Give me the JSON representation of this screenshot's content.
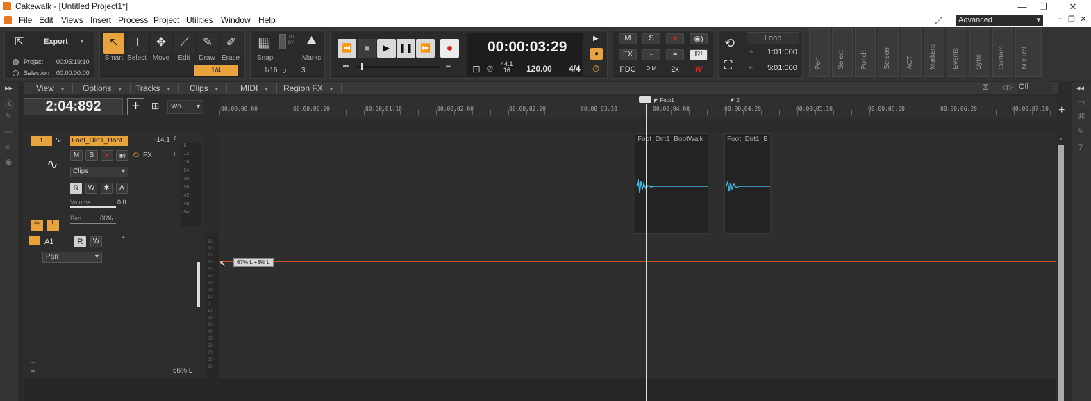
{
  "window": {
    "title": "Cakewalk - [Untitled Project1*]"
  },
  "menu": [
    "File",
    "Edit",
    "Views",
    "Insert",
    "Process",
    "Project",
    "Utilities",
    "Window",
    "Help"
  ],
  "workspace": "Advanced",
  "export": {
    "label": "Export",
    "project_label": "Project",
    "project_time": "00:05:19:10",
    "selection_label": "Selection",
    "selection_time": "00:00:00:00"
  },
  "tools": [
    {
      "name": "smart-tool",
      "label": "Smart",
      "glyph": "↖"
    },
    {
      "name": "select-tool",
      "label": "Select",
      "glyph": "I"
    },
    {
      "name": "move-tool",
      "label": "Move",
      "glyph": "✥"
    },
    {
      "name": "edit-tool",
      "label": "Edit",
      "glyph": "⟋"
    },
    {
      "name": "draw-tool",
      "label": "Draw",
      "glyph": "✎"
    },
    {
      "name": "erase-tool",
      "label": "Erase",
      "glyph": "✐"
    }
  ],
  "snap": {
    "snap_label": "Snap",
    "marks_label": "Marks",
    "value": "1/4",
    "grid": "1/16",
    "note_count": "3",
    "dot": ".",
    "to_by": "TO BY"
  },
  "transport": {
    "time": "00:00:03:29",
    "sample_rate": "44.1",
    "bit_depth": "16",
    "tempo": "120.00",
    "meter": "4/4"
  },
  "mix": {
    "m": "M",
    "s": "S",
    "fx": "FX",
    "r": "R!",
    "pdc": "PDC",
    "dim": "DIM",
    "x2": "2x",
    "w": "W"
  },
  "loop": {
    "label": "Loop",
    "start": "1:01:000",
    "end": "5:01:000"
  },
  "modules": [
    "Perf",
    "Select",
    "Punch",
    "Screen",
    "ACT",
    "Markers",
    "Events",
    "Sync",
    "Custom",
    "Mix Rcl"
  ],
  "track_view_menu": [
    "View",
    "Options",
    "Tracks",
    "Clips",
    "MIDI",
    "Region FX"
  ],
  "snap_off": "Off",
  "now_time": "2:04:892",
  "now_format": "Wo...",
  "ruler": {
    "markers": [
      {
        "label": "Foot1"
      },
      {
        "label": "2"
      }
    ],
    "labels": [
      "00:00:00:00",
      "00:00:00:20",
      "00:00:01:10",
      "00:00:02:00",
      "00:00:02:20",
      "00:00:03:10",
      "00:00:04:00",
      "00:00:04:20",
      "00:00:05:10",
      "00:00:06:00",
      "00:00:06:20",
      "00:00:07:10"
    ]
  },
  "track1": {
    "number": "1",
    "name": "Foot_Dirt1_Boot",
    "gain": "-14.1",
    "m": "M",
    "s": "S",
    "fx": "FX",
    "clips_mode": "Clips",
    "r": "R",
    "w": "W",
    "star": "✱",
    "a": "A",
    "volume_label": "Volume",
    "volume_value": "0.0",
    "pan_label": "Pan",
    "pan_value": "66% L",
    "meter_scale": [
      "-6",
      "-12",
      "-18",
      "-24",
      "-30",
      "-36",
      "-42",
      "-48",
      "-54"
    ]
  },
  "clips": [
    {
      "name": "Foot_Dirt1_BootWalk"
    },
    {
      "name": "Foot_Dirt1_B"
    }
  ],
  "track2": {
    "name": "A1",
    "r": "R",
    "w": "W",
    "param": "Pan",
    "pan_value": "66% L",
    "minus": "–",
    "plus": "+",
    "scale": [
      "90",
      "80",
      "70",
      "60",
      "50",
      "40",
      "30",
      "20",
      "10",
      "0",
      "10",
      "20",
      "30",
      "40",
      "50",
      "60",
      "70",
      "80",
      "90"
    ]
  },
  "automation_tooltip": "67% L  +3% L",
  "colors": {
    "accent": "#e8a33d",
    "waveform": "#3fb6d6",
    "automation": "#c8531e",
    "active_tool": "#e8a33d"
  }
}
